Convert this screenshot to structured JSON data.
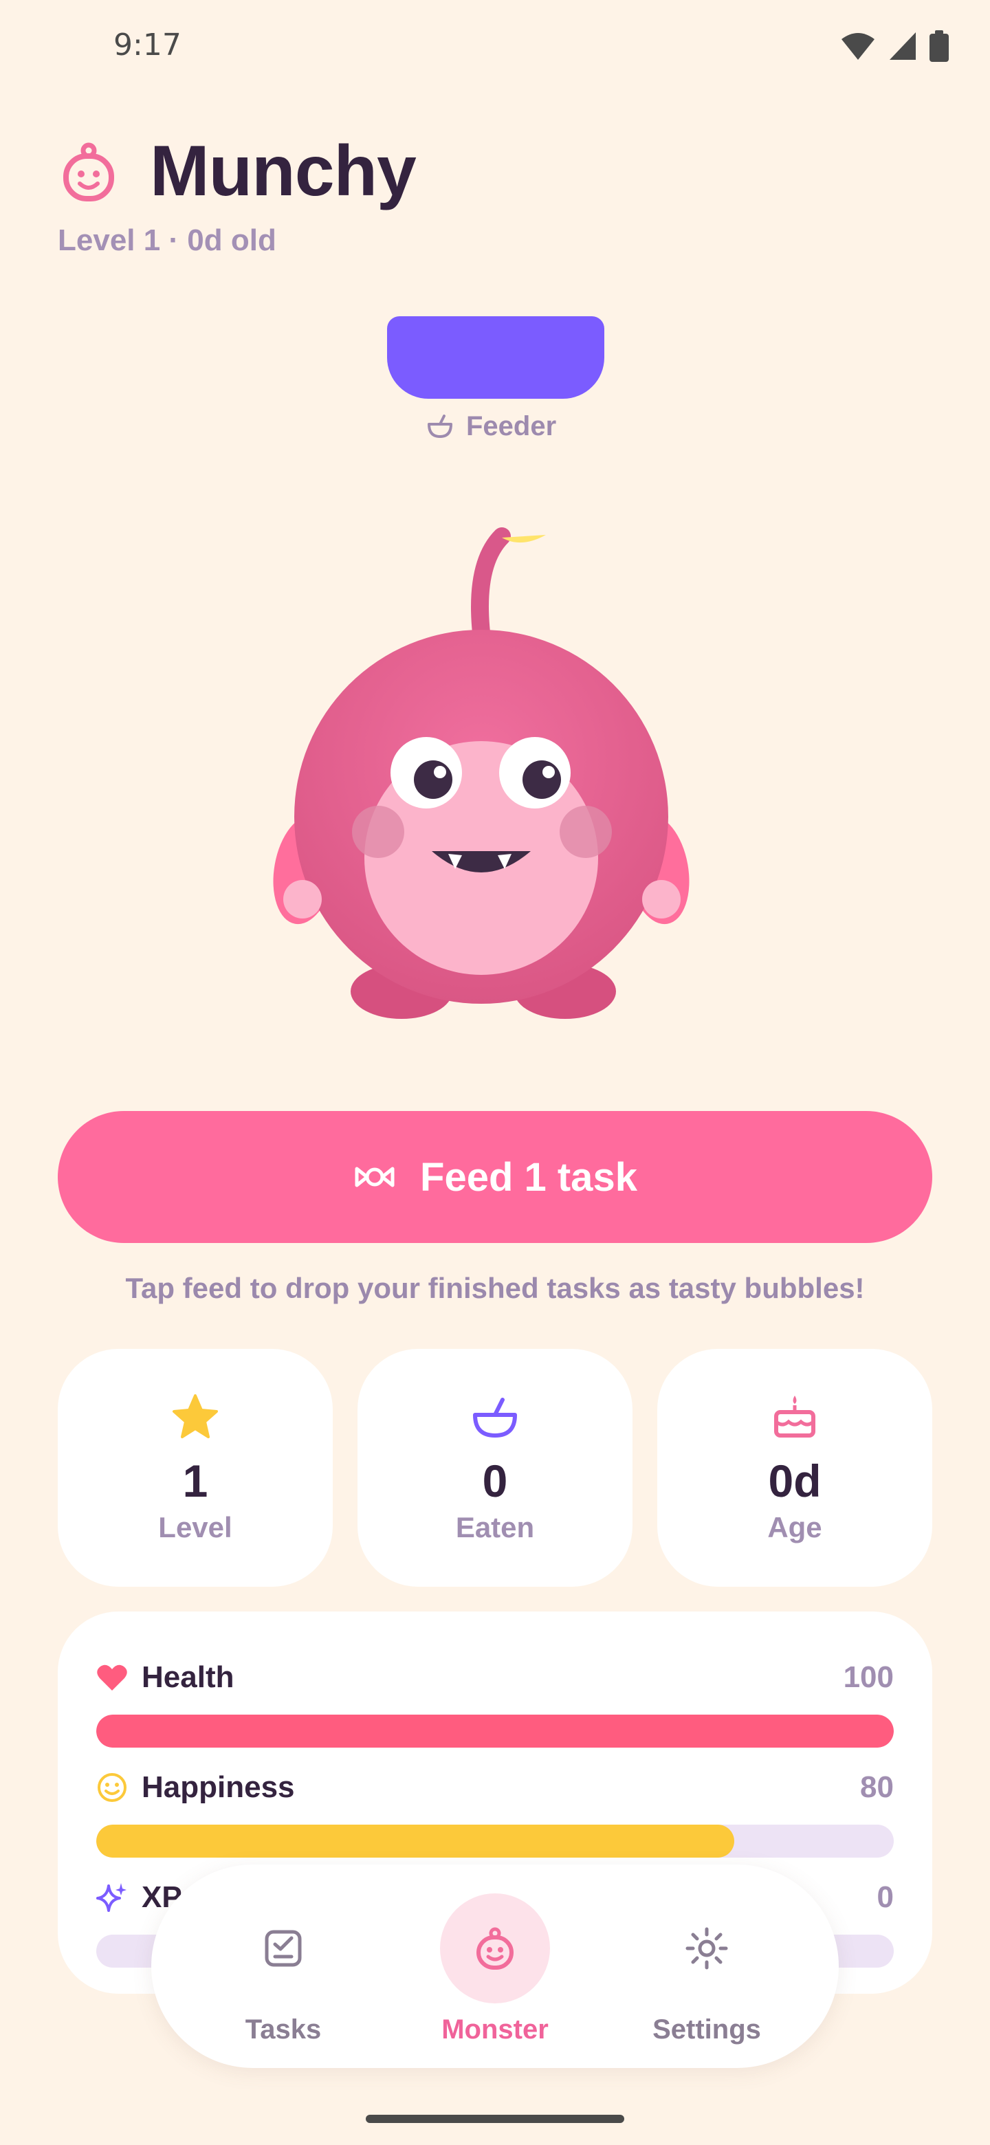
{
  "status_bar": {
    "time": "9:17",
    "icons": [
      "wifi-icon",
      "signal-icon",
      "battery-icon"
    ]
  },
  "header": {
    "icon": "monster-face-icon",
    "title": "Munchy",
    "subtitle": "Level 1 · 0d old"
  },
  "feeder": {
    "label": "Feeder",
    "icon": "bowl-icon",
    "color": "#7B5CFF"
  },
  "feed_button": {
    "label": "Feed 1 task",
    "icon": "candy-icon",
    "color": "#FF6B9D"
  },
  "hint": "Tap feed to drop your finished tasks as tasty bubbles!",
  "stats": [
    {
      "icon": "star-icon",
      "value": "1",
      "label": "Level"
    },
    {
      "icon": "bowl-icon",
      "value": "0",
      "label": "Eaten"
    },
    {
      "icon": "cake-icon",
      "value": "0d",
      "label": "Age"
    }
  ],
  "meters": [
    {
      "icon": "heart-icon",
      "name": "Health",
      "value": "100",
      "fraction": 1.0,
      "color": "#FF5C7F"
    },
    {
      "icon": "smile-icon",
      "name": "Happiness",
      "value": "80",
      "fraction": 0.8,
      "color": "#FCC93A"
    },
    {
      "icon": "sparkle-icon",
      "name": "XP",
      "value": "0",
      "fraction": 0.0,
      "color": "#7B5CFF"
    }
  ],
  "nav": {
    "items": [
      {
        "icon": "tasks-icon",
        "label": "Tasks",
        "active": false
      },
      {
        "icon": "monster-icon",
        "label": "Monster",
        "active": true
      },
      {
        "icon": "settings-icon",
        "label": "Settings",
        "active": false
      }
    ]
  },
  "colors": {
    "background": "#FEF3E7",
    "text": "#34233F",
    "muted": "#A08EB1",
    "accent": "#F0639A"
  }
}
